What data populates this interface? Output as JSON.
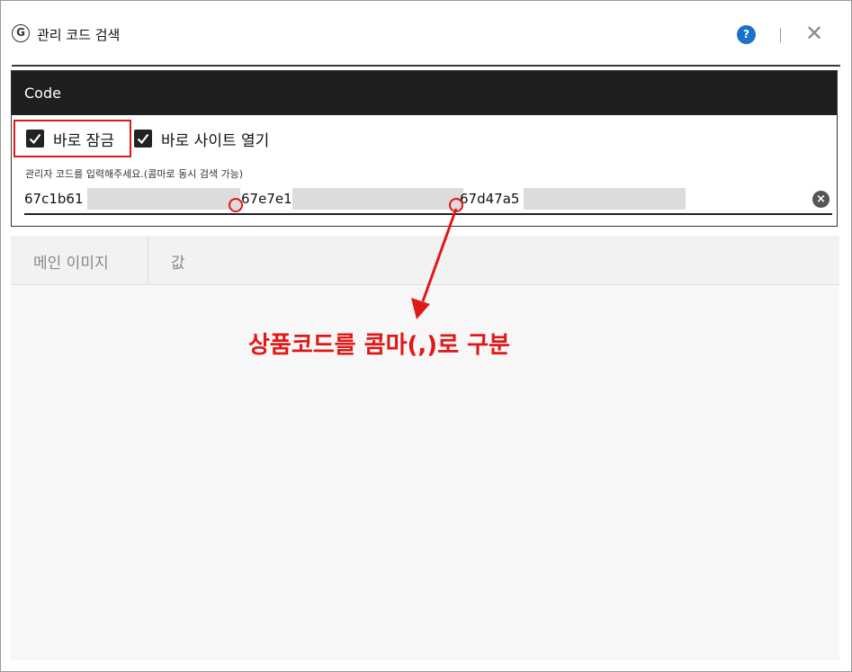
{
  "window": {
    "title": "관리 코드 검색",
    "logo_glyph": "G",
    "help_glyph": "?",
    "close_glyph": "✕"
  },
  "code_panel": {
    "header": "Code",
    "options": [
      {
        "label": "바로 잠금",
        "checked": true,
        "highlighted": true
      },
      {
        "label": "바로 사이트 열기",
        "checked": true,
        "highlighted": false
      }
    ],
    "input_label": "관리자 코드를 입력해주세요.(콤마로 동시 검색 가능)",
    "input_segments": [
      "67c1b61",
      "67e7e1",
      "67d47a5"
    ],
    "clear_glyph": "×"
  },
  "table": {
    "columns": [
      "메인 이미지",
      "값"
    ]
  },
  "annotation": {
    "text": "상품코드를 콤마(,)로 구분",
    "color": "#e01818"
  },
  "colors": {
    "header_bg": "#1f1f1f",
    "accent_blue": "#1a73c9",
    "annotation_red": "#e01818"
  }
}
